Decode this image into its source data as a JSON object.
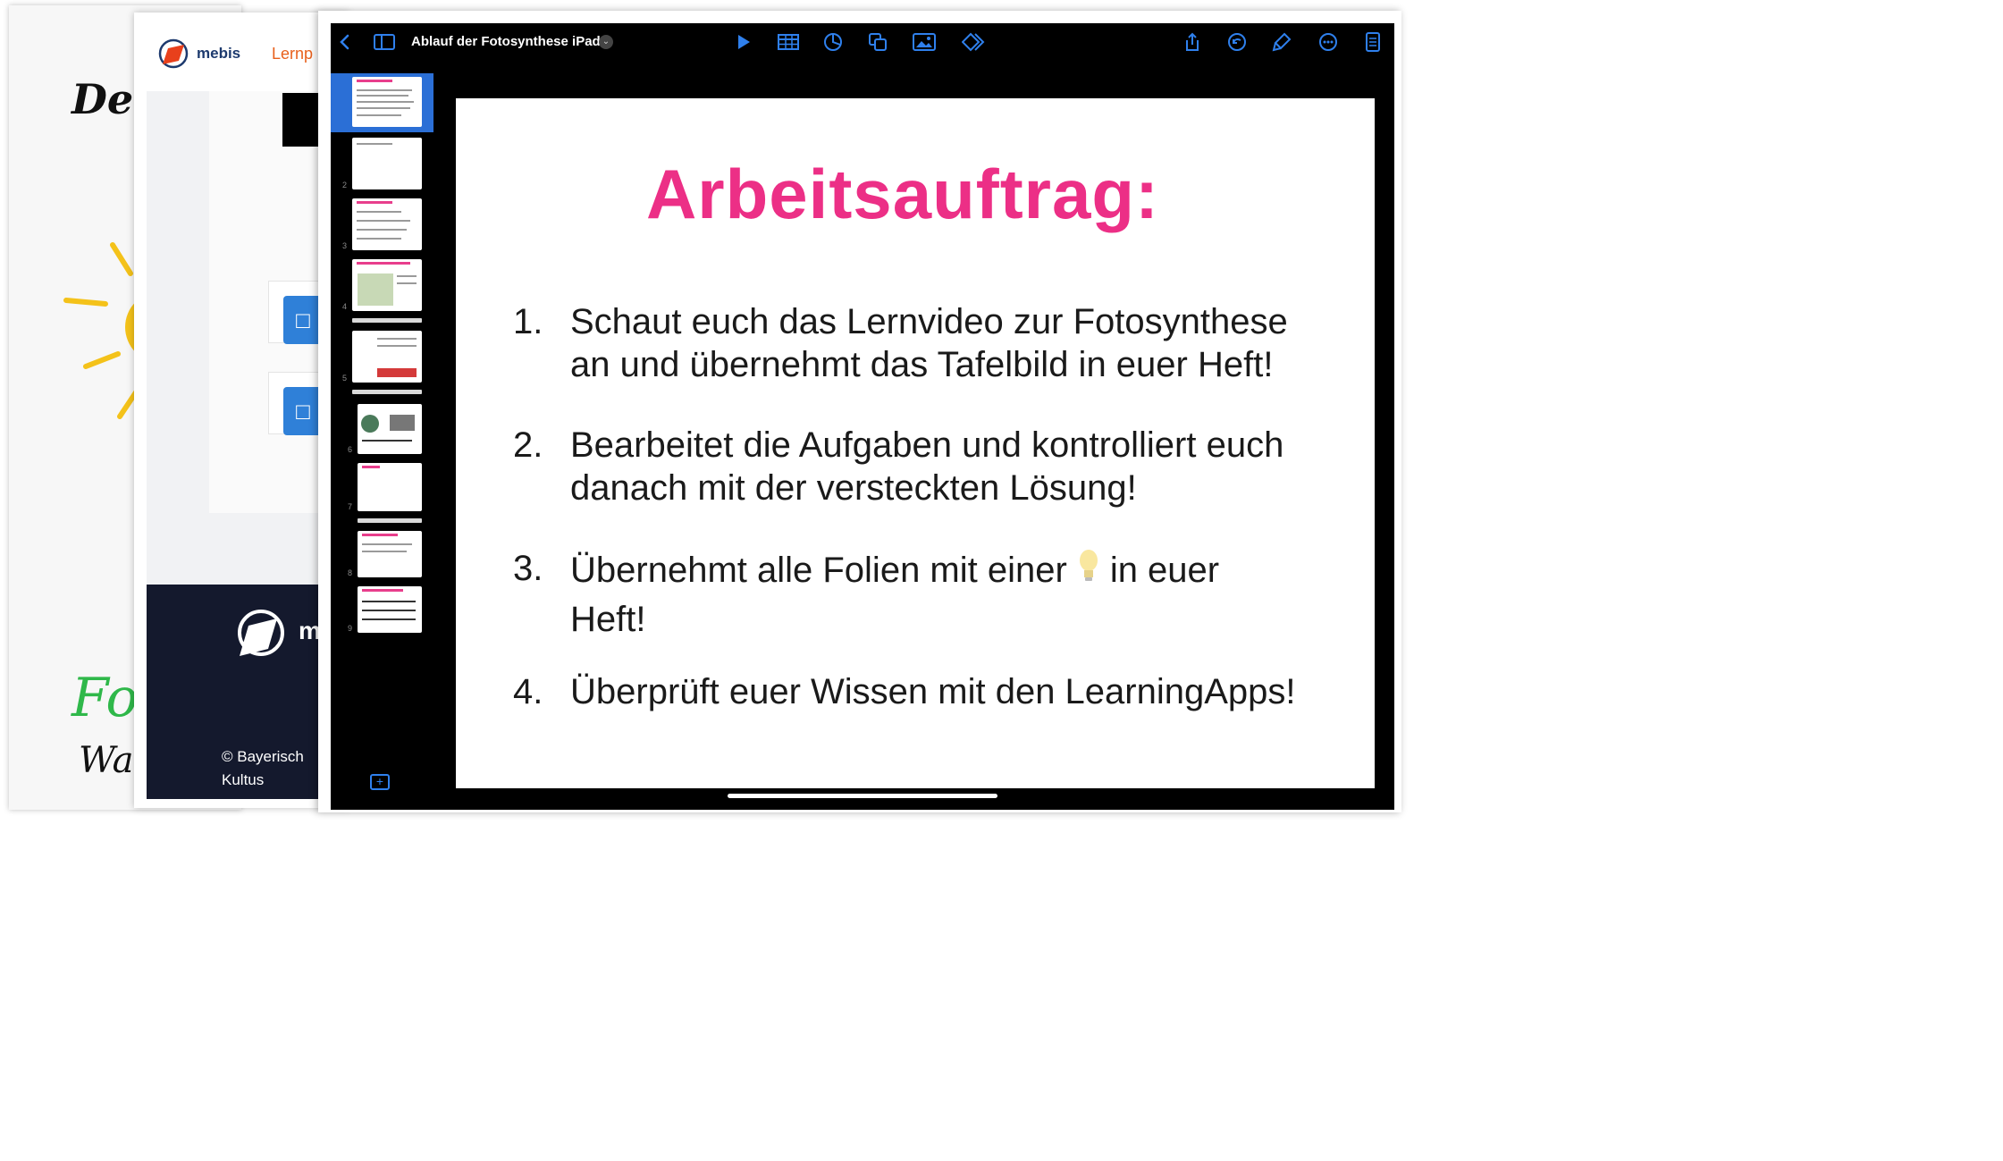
{
  "background_cards": {
    "handwritten": {
      "title_fragment": "Der",
      "word_green": "Fot",
      "word_black": "Was"
    },
    "mebis": {
      "brand": "mebis",
      "nav_fragment": "Lernp",
      "footer_brand_fragment": "m",
      "copyright": "© Bayerisch Kultus"
    }
  },
  "toolbar": {
    "back_icon": "chevron-left-icon",
    "sidebar_icon": "sidebar-icon",
    "document_title": "Ablauf der Fotosynthese iPad",
    "title_menu_icon": "chevron-down-icon",
    "center_tools": [
      "play-icon",
      "table-icon",
      "chart-icon",
      "shapes-icon",
      "media-icon",
      "animate-icon"
    ],
    "right_tools": [
      "share-icon",
      "undo-icon",
      "format-brush-icon",
      "more-icon",
      "document-icon"
    ],
    "accent": "#2f80ed"
  },
  "navigator": {
    "selected_slide": 1,
    "slides": [
      "",
      "2",
      "3",
      "4",
      "5",
      "6",
      "7",
      "8",
      "9"
    ],
    "add_slide_icon": "add-slide-icon"
  },
  "slide": {
    "title": "Arbeitsauftrag:",
    "title_color": "#ec2f86",
    "steps": [
      {
        "num": "1.",
        "line1": "Schaut euch das Lernvideo zur Fotosynthese",
        "line2": "an und übernehmt das Tafelbild in euer Heft!"
      },
      {
        "num": "2.",
        "line1": "Bearbeitet die Aufgaben und kontrolliert euch",
        "line2": "danach mit der versteckten Lösung!"
      },
      {
        "num": "3.",
        "line1_a": "Übernehmt alle Folien mit einer",
        "line1_b": "in euer",
        "line2": "Heft!",
        "icon": "lightbulb-icon"
      },
      {
        "num": "4.",
        "line1": "Überprüft euer Wissen mit den LearningApps!"
      }
    ]
  }
}
